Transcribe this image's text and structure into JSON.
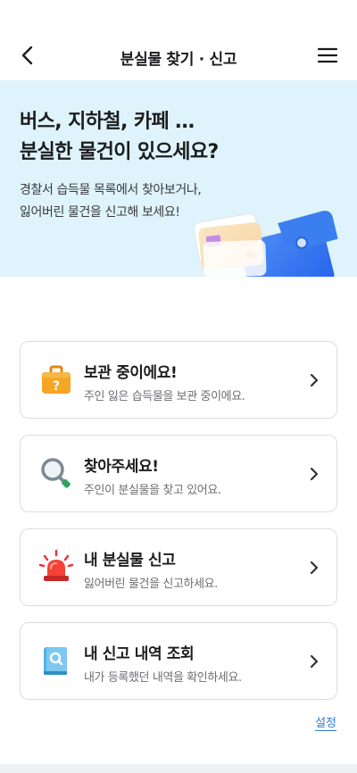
{
  "header": {
    "title": "분실물 찾기 · 신고",
    "back_icon": "chevron-left-icon",
    "menu_icon": "hamburger-menu-icon"
  },
  "hero": {
    "title_line1": "버스, 지하철, 카페 …",
    "title_line2": "분실한 물건이 있으세요?",
    "desc_line1": "경찰서 습득물 목록에서 찾아보거나,",
    "desc_line2": "잃어버린 물건을 신고해 보세요!",
    "background_color": "#def3fb",
    "illustration": "wallet-with-cards-icon"
  },
  "menu": [
    {
      "title": "보관 중이에요!",
      "subtitle": "주인 잃은 습득물을 보관 중이에요.",
      "icon": "briefcase-question-icon"
    },
    {
      "title": "찾아주세요!",
      "subtitle": "주인이 분실물을 찾고 있어요.",
      "icon": "magnifier-icon"
    },
    {
      "title": "내 분실물 신고",
      "subtitle": "잃어버린 물건을 신고하세요.",
      "icon": "siren-icon"
    },
    {
      "title": "내 신고 내역 조회",
      "subtitle": "내가 등록했던 내역을 확인하세요.",
      "icon": "search-document-icon"
    }
  ],
  "settings_label": "설정",
  "colors": {
    "accent": "#2b7bd6",
    "hero_bg": "#def3fb"
  }
}
